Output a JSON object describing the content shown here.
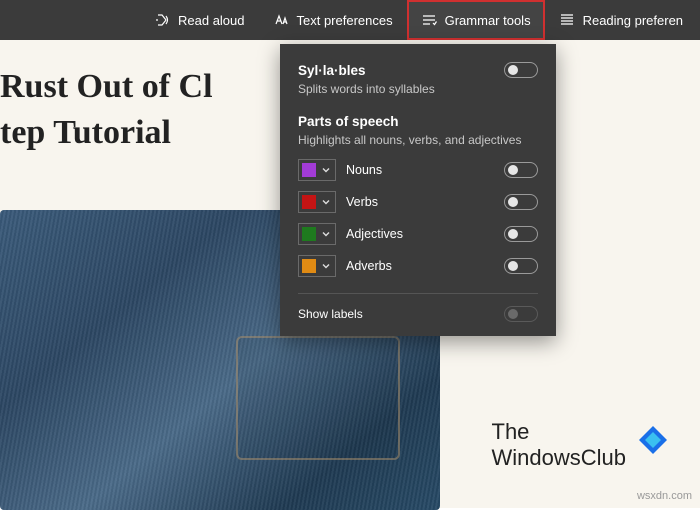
{
  "toolbar": {
    "read_aloud": "Read aloud",
    "text_prefs": "Text preferences",
    "grammar_tools": "Grammar tools",
    "reading_prefs": "Reading preferen"
  },
  "headline": {
    "line1": "Rust Out of Cl",
    "line2": "tep Tutorial"
  },
  "panel": {
    "syllables_title": "Syl·la·bles",
    "syllables_sub": "Splits words into syllables",
    "pos_title": "Parts of speech",
    "pos_sub": "Highlights all nouns, verbs, and adjectives",
    "items": [
      {
        "label": "Nouns",
        "color": "#a23bd6"
      },
      {
        "label": "Verbs",
        "color": "#c41414"
      },
      {
        "label": "Adjectives",
        "color": "#1e7a1e"
      },
      {
        "label": "Adverbs",
        "color": "#e08b14"
      }
    ],
    "show_labels": "Show labels"
  },
  "brand": {
    "line1": "The",
    "line2": "WindowsClub"
  },
  "watermark": "wsxdn.com"
}
